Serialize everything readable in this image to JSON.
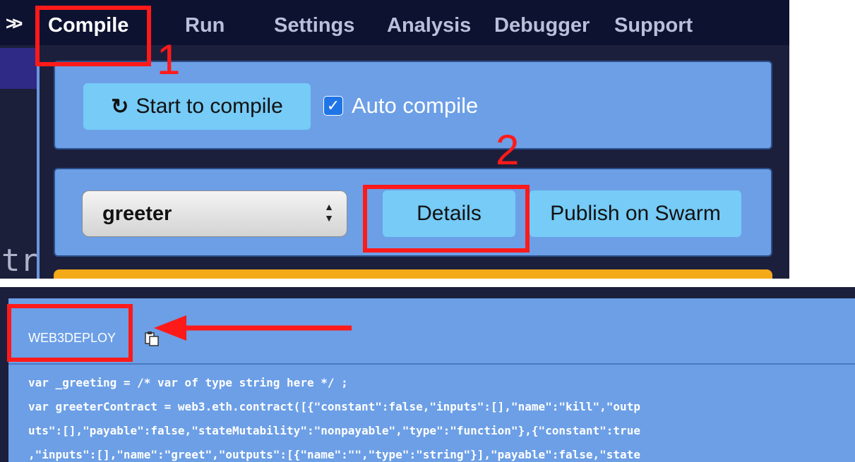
{
  "tabs": [
    {
      "label": "Compile",
      "active": true
    },
    {
      "label": "Run"
    },
    {
      "label": "Settings"
    },
    {
      "label": "Analysis"
    },
    {
      "label": "Debugger"
    },
    {
      "label": "Support"
    }
  ],
  "compile_panel": {
    "compile_button_label": "Start to compile",
    "auto_compile_label": "Auto compile",
    "auto_compile_checked": true
  },
  "details_panel": {
    "contract_select_value": "greeter",
    "details_button_label": "Details",
    "publish_button_label": "Publish on Swarm"
  },
  "editor_fragment": "tr",
  "web3deploy": {
    "label": "WEB3DEPLOY",
    "code_lines": [
      "var _greeting = /* var of type string here */ ;",
      "var greeterContract = web3.eth.contract([{\"constant\":false,\"inputs\":[],\"name\":\"kill\",\"outp",
      "uts\":[],\"payable\":false,\"stateMutability\":\"nonpayable\",\"type\":\"function\"},{\"constant\":true",
      ",\"inputs\":[],\"name\":\"greet\",\"outputs\":[{\"name\":\"\",\"type\":\"string\"}],\"payable\":false,\"state"
    ]
  },
  "annotations": {
    "step1": "1",
    "step2": "2"
  },
  "colors": {
    "panel": "#6c9fe6",
    "button": "#76cbf7",
    "annotation_red": "#ff1a1a",
    "dark_bg": "#0e1231"
  }
}
